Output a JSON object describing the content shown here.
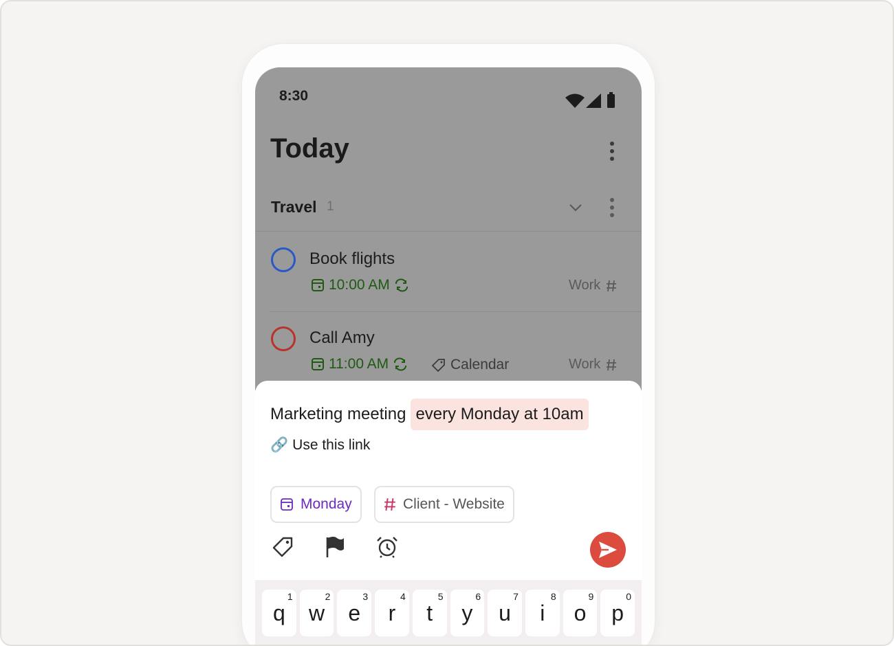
{
  "status_bar": {
    "time": "8:30"
  },
  "header": {
    "title": "Today"
  },
  "section": {
    "name": "Travel",
    "count": "1"
  },
  "tasks": [
    {
      "name": "Book flights",
      "due": "10:00 AM",
      "label": "",
      "project": "Work",
      "priority_color": "#2a58c8"
    },
    {
      "name": "Call Amy",
      "due": "11:00 AM",
      "label": "Calendar",
      "project": "Work",
      "priority_color": "#b8332c"
    }
  ],
  "quick_add": {
    "task_text": "Marketing meeting",
    "parsed_date_text": "every Monday at 10am",
    "link_emoji": "🔗",
    "link_text": "Use this link",
    "date_chip": "Monday",
    "project_chip": "Client - Website"
  },
  "keyboard": {
    "keys": [
      {
        "letter": "q",
        "num": "1"
      },
      {
        "letter": "w",
        "num": "2"
      },
      {
        "letter": "e",
        "num": "3"
      },
      {
        "letter": "r",
        "num": "4"
      },
      {
        "letter": "t",
        "num": "5"
      },
      {
        "letter": "y",
        "num": "6"
      },
      {
        "letter": "u",
        "num": "7"
      },
      {
        "letter": "i",
        "num": "8"
      },
      {
        "letter": "o",
        "num": "9"
      },
      {
        "letter": "p",
        "num": "0"
      }
    ]
  },
  "colors": {
    "accent": "#dc4c3e",
    "due_green": "#1e5a12",
    "date_purple": "#6c2ac2",
    "project_pink": "#c93a6a",
    "highlight": "#fbe3e0"
  }
}
